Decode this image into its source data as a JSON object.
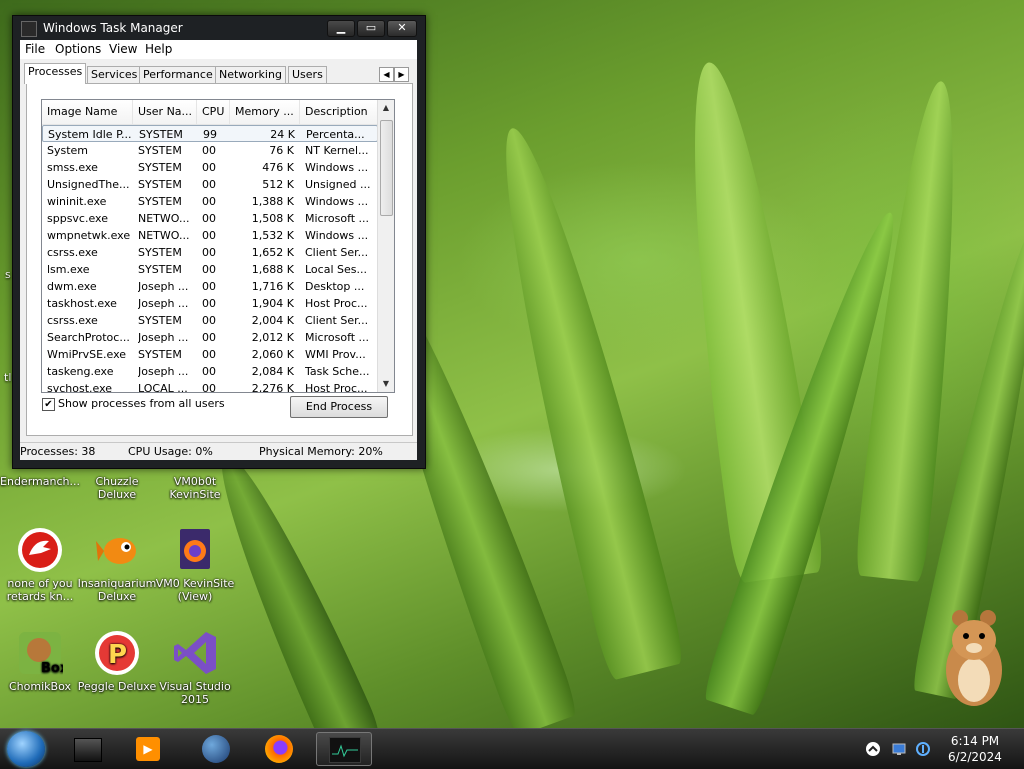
{
  "window": {
    "title": "Windows Task Manager",
    "menu": [
      "File",
      "Options",
      "View",
      "Help"
    ],
    "tabs": [
      "Processes",
      "Services",
      "Performance",
      "Networking",
      "Users"
    ],
    "active_tab": "Processes",
    "columns": [
      "Image Name",
      "User Na...",
      "CPU",
      "Memory ...",
      "Description"
    ],
    "rows": [
      {
        "name": "System Idle P...",
        "user": "SYSTEM",
        "cpu": "99",
        "mem": "24 K",
        "desc": "Percenta..."
      },
      {
        "name": "System",
        "user": "SYSTEM",
        "cpu": "00",
        "mem": "76 K",
        "desc": "NT Kernel..."
      },
      {
        "name": "smss.exe",
        "user": "SYSTEM",
        "cpu": "00",
        "mem": "476 K",
        "desc": "Windows ..."
      },
      {
        "name": "UnsignedThe...",
        "user": "SYSTEM",
        "cpu": "00",
        "mem": "512 K",
        "desc": "Unsigned ..."
      },
      {
        "name": "wininit.exe",
        "user": "SYSTEM",
        "cpu": "00",
        "mem": "1,388 K",
        "desc": "Windows ..."
      },
      {
        "name": "sppsvc.exe",
        "user": "NETWO...",
        "cpu": "00",
        "mem": "1,508 K",
        "desc": "Microsoft ..."
      },
      {
        "name": "wmpnetwk.exe",
        "user": "NETWO...",
        "cpu": "00",
        "mem": "1,532 K",
        "desc": "Windows ..."
      },
      {
        "name": "csrss.exe",
        "user": "SYSTEM",
        "cpu": "00",
        "mem": "1,652 K",
        "desc": "Client Ser..."
      },
      {
        "name": "lsm.exe",
        "user": "SYSTEM",
        "cpu": "00",
        "mem": "1,688 K",
        "desc": "Local Ses..."
      },
      {
        "name": "dwm.exe",
        "user": "Joseph ...",
        "cpu": "00",
        "mem": "1,716 K",
        "desc": "Desktop ..."
      },
      {
        "name": "taskhost.exe",
        "user": "Joseph ...",
        "cpu": "00",
        "mem": "1,904 K",
        "desc": "Host Proc..."
      },
      {
        "name": "csrss.exe",
        "user": "SYSTEM",
        "cpu": "00",
        "mem": "2,004 K",
        "desc": "Client Ser..."
      },
      {
        "name": "SearchProtoc...",
        "user": "Joseph ...",
        "cpu": "00",
        "mem": "2,012 K",
        "desc": "Microsoft ..."
      },
      {
        "name": "WmiPrvSE.exe",
        "user": "SYSTEM",
        "cpu": "00",
        "mem": "2,060 K",
        "desc": "WMI Prov..."
      },
      {
        "name": "taskeng.exe",
        "user": "Joseph ...",
        "cpu": "00",
        "mem": "2,084 K",
        "desc": "Task Sche..."
      },
      {
        "name": "svchost.exe",
        "user": "LOCAL ...",
        "cpu": "00",
        "mem": "2,276 K",
        "desc": "Host Proc..."
      }
    ],
    "show_all_label": "Show processes from all users",
    "show_all_checked": true,
    "end_process_label": "End Process",
    "status": {
      "processes": "Processes: 38",
      "cpu": "CPU Usage: 0%",
      "memory": "Physical Memory: 20%"
    }
  },
  "desktop_icons": [
    {
      "label": "Endermanch...",
      "icon": "file-icon"
    },
    {
      "label": "Chuzzle Deluxe",
      "icon": "chuzzle-icon"
    },
    {
      "label": "VM0b0t KevinSite",
      "icon": "vm-icon"
    },
    {
      "label": "none of you retards kn...",
      "icon": "red-dragon-icon"
    },
    {
      "label": "Insaniquarium Deluxe",
      "icon": "goldfish-icon"
    },
    {
      "label": "VM0 KevinSite (View)",
      "icon": "firefox-file-icon"
    },
    {
      "label": "ChomikBox",
      "icon": "hamster-box-icon"
    },
    {
      "label": "Peggle Deluxe",
      "icon": "peggle-icon"
    },
    {
      "label": "Visual Studio 2015",
      "icon": "visual-studio-icon"
    }
  ],
  "edge_glyphs": {
    "s1": "s",
    "t1": "tl"
  },
  "taskbar": {
    "items": [
      "file-explorer-icon",
      "media-player-icon",
      "globe-icon",
      "firefox-icon",
      "task-manager-icon"
    ],
    "time": "6:14 PM",
    "date": "6/2/2024"
  },
  "colors": {
    "accent": "#1f6bb8",
    "titlebar": "#1e2124"
  }
}
